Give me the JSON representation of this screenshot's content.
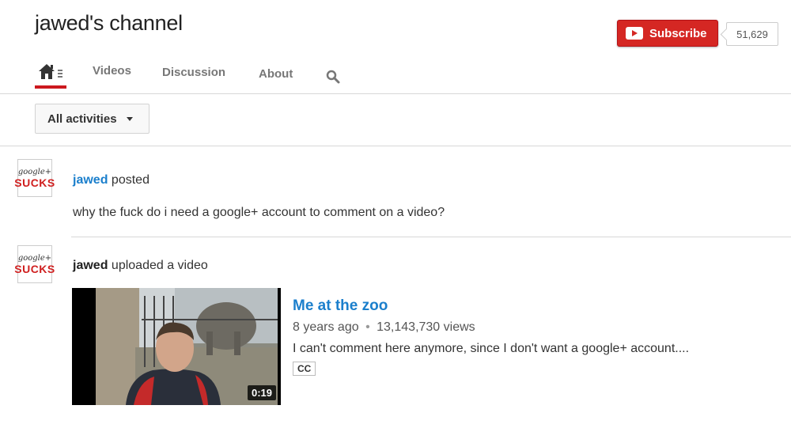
{
  "channel": {
    "title": "jawed's channel",
    "subscribe_label": "Subscribe",
    "subscriber_count": "51,629"
  },
  "tabs": {
    "home_icon": "home-icon",
    "items": [
      {
        "label": "Videos"
      },
      {
        "label": "Discussion"
      },
      {
        "label": "About"
      }
    ],
    "search_icon": "search-icon",
    "active_color": "#cc181e"
  },
  "filter": {
    "selected": "All activities"
  },
  "feed": {
    "items": [
      {
        "avatar": {
          "line1": "google+",
          "line2": "SUCKS"
        },
        "author": "jawed",
        "action": "posted",
        "text": "why the fuck do i need a google+ account to comment on a video?"
      },
      {
        "avatar": {
          "line1": "google+",
          "line2": "SUCKS"
        },
        "author": "jawed",
        "action": "uploaded a video",
        "video": {
          "title": "Me at the zoo",
          "age": "8 years ago",
          "separator": "•",
          "views": "13,143,730 views",
          "description": "I can't comment here anymore, since I don't want a google+ account....",
          "badge": "CC",
          "duration": "0:19"
        }
      }
    ]
  },
  "colors": {
    "subscribe_red": "#d52723",
    "link_blue": "#1b7fcc"
  }
}
